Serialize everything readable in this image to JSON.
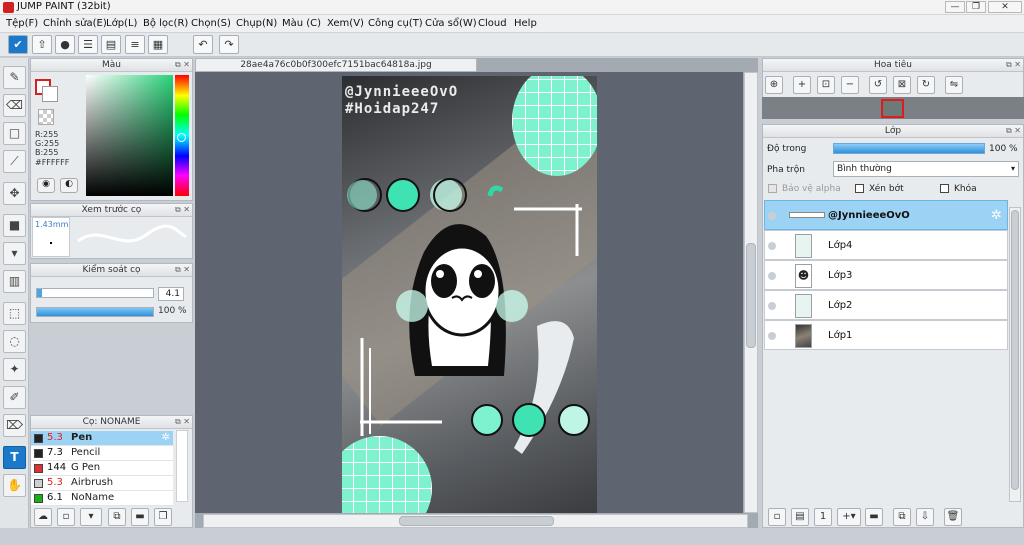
{
  "app": {
    "title": "JUMP PAINT (32bit)"
  },
  "menu": [
    "Tệp(F)",
    "Chỉnh sửa(E)",
    "Lớp(L)",
    "Bộ lọc(R)",
    "Chọn(S)",
    "Chụp(N)",
    "Màu (C)",
    "Xem(V)",
    "Công cụ(T)",
    "Cửa sổ(W)",
    "Cloud",
    "Help"
  ],
  "color_panel": {
    "title": "Màu",
    "r": "R:255",
    "g": "G:255",
    "b": "B:255",
    "hex": "#FFFFFF"
  },
  "brush_preview": {
    "title": "Xem trước cọ",
    "size": "1.43mm"
  },
  "brush_control": {
    "title": "Kiểm soát cọ",
    "size_value": "4.1",
    "opacity_value": "100 %",
    "size_fraction": 0.04,
    "opacity_fraction": 1.0
  },
  "brush_list": {
    "title": "Cọ: NONAME",
    "items": [
      {
        "size": "5.3",
        "name": "Pen",
        "color": "#222222",
        "size_color": "#e02020"
      },
      {
        "size": "7.3",
        "name": "Pencil",
        "color": "#222222",
        "size_color": "#111111"
      },
      {
        "size": "144",
        "name": "G Pen",
        "color": "#e03030",
        "size_color": "#111111"
      },
      {
        "size": "5.3",
        "name": "Airbrush",
        "color": "#cfcfcf",
        "size_color": "#e02020"
      },
      {
        "size": "6.1",
        "name": "NoName",
        "color": "#18b018",
        "size_color": "#111111"
      }
    ]
  },
  "document": {
    "tab": "28ae4a76c0b0f300efc7151bac64818a.jpg"
  },
  "artwork": {
    "line1": "@JynnieeeOvO",
    "line2": "#Hoidap247"
  },
  "navigator": {
    "title": "Hoa tiêu"
  },
  "layers_panel": {
    "title": "Lớp",
    "opacity_label": "Độ trong",
    "opacity_value": "100 %",
    "blend_label": "Pha trộn",
    "blend_value": "Bình thường",
    "protect_alpha": "Bảo vệ alpha",
    "clip": "Xén bớt",
    "lock": "Khóa",
    "layers": [
      "@JynnieeeOvO",
      "Lớp4",
      "Lớp3",
      "Lớp2",
      "Lớp1"
    ]
  },
  "colors": {
    "accent": "#1b79c9",
    "mint": "#7ef1cf",
    "selected": "#9cd2f4"
  }
}
